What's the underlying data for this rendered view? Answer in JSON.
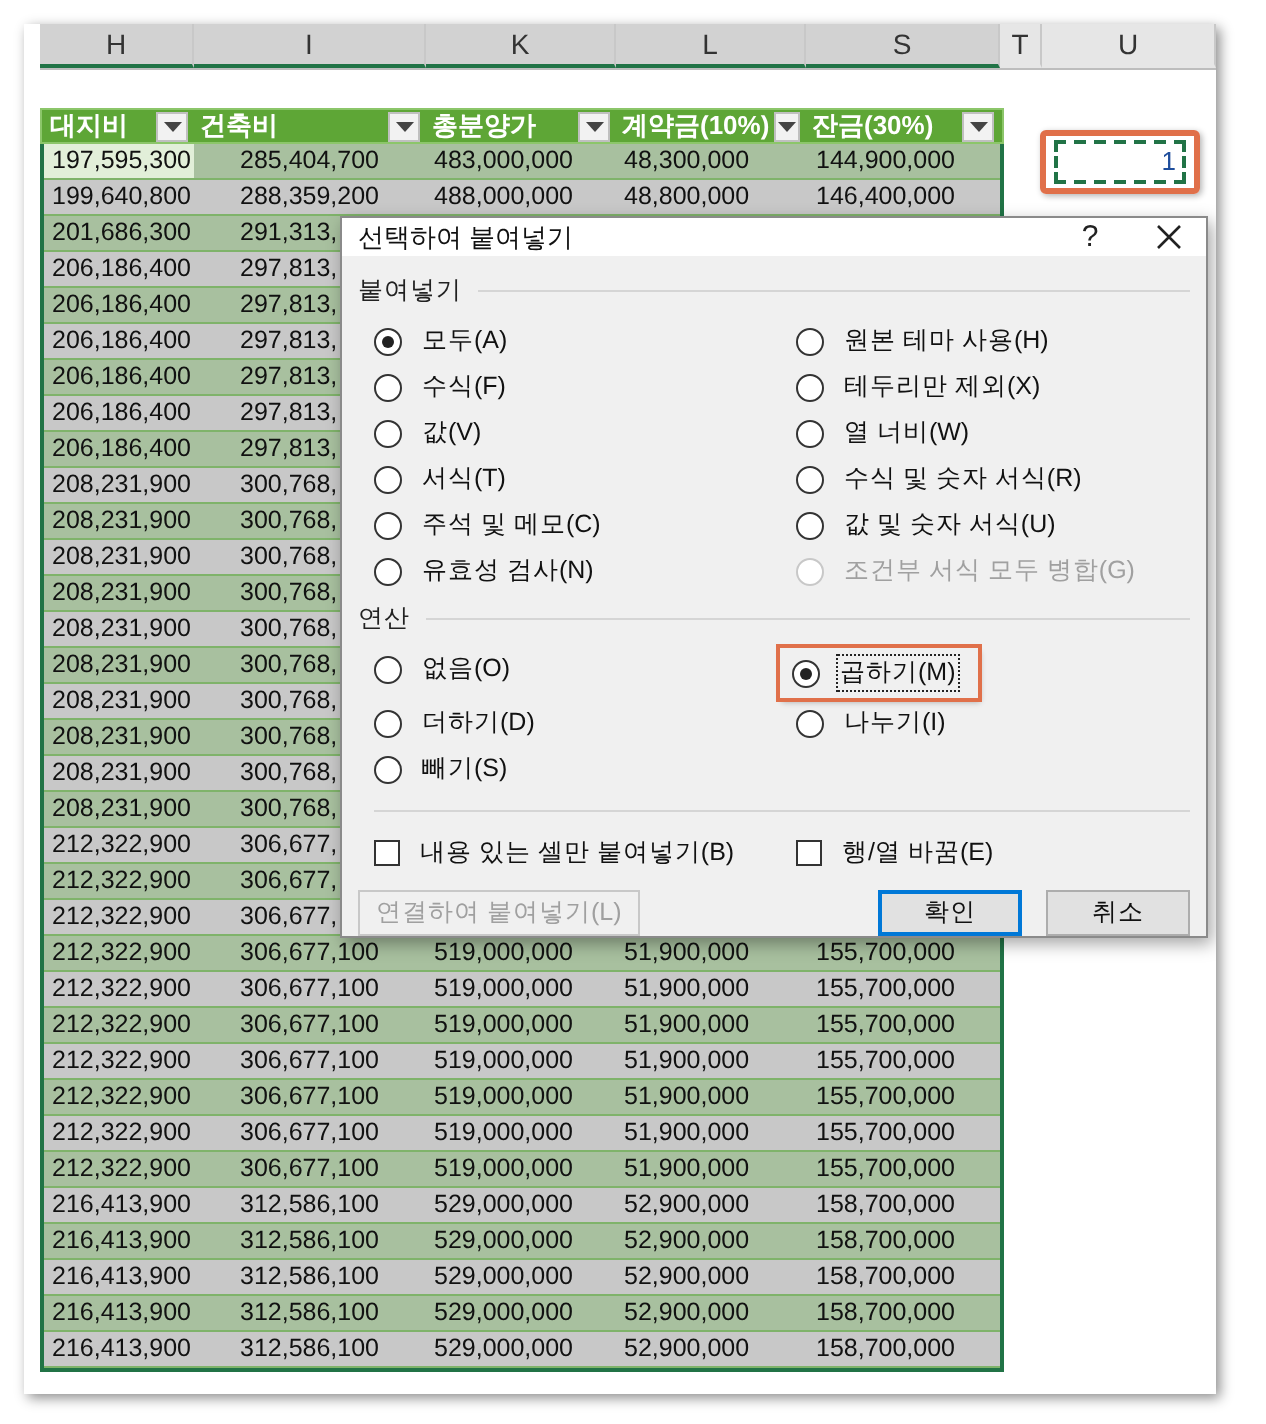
{
  "column_letters": [
    "H",
    "I",
    "K",
    "L",
    "S",
    "T",
    "U"
  ],
  "table": {
    "headers": [
      "대지비",
      "건축비",
      "총분양가",
      "계약금(10%)",
      "잔금(30%)"
    ],
    "rows": [
      {
        "current": true,
        "cells": [
          "197,595,300",
          "285,404,700",
          "483,000,000",
          "48,300,000",
          "144,900,000"
        ]
      },
      {
        "current": false,
        "cells": [
          "199,640,800",
          "288,359,200",
          "488,000,000",
          "48,800,000",
          "146,400,000"
        ]
      },
      {
        "current": false,
        "cells": [
          "201,686,300",
          "291,313,"
        ]
      },
      {
        "current": false,
        "cells": [
          "206,186,400",
          "297,813,"
        ]
      },
      {
        "current": false,
        "cells": [
          "206,186,400",
          "297,813,"
        ]
      },
      {
        "current": false,
        "cells": [
          "206,186,400",
          "297,813,"
        ]
      },
      {
        "current": false,
        "cells": [
          "206,186,400",
          "297,813,"
        ]
      },
      {
        "current": false,
        "cells": [
          "206,186,400",
          "297,813,"
        ]
      },
      {
        "current": false,
        "cells": [
          "206,186,400",
          "297,813,"
        ]
      },
      {
        "current": false,
        "cells": [
          "208,231,900",
          "300,768,"
        ]
      },
      {
        "current": false,
        "cells": [
          "208,231,900",
          "300,768,"
        ]
      },
      {
        "current": false,
        "cells": [
          "208,231,900",
          "300,768,"
        ]
      },
      {
        "current": false,
        "cells": [
          "208,231,900",
          "300,768,"
        ]
      },
      {
        "current": false,
        "cells": [
          "208,231,900",
          "300,768,"
        ]
      },
      {
        "current": false,
        "cells": [
          "208,231,900",
          "300,768,"
        ]
      },
      {
        "current": false,
        "cells": [
          "208,231,900",
          "300,768,"
        ]
      },
      {
        "current": false,
        "cells": [
          "208,231,900",
          "300,768,"
        ]
      },
      {
        "current": false,
        "cells": [
          "208,231,900",
          "300,768,"
        ]
      },
      {
        "current": false,
        "cells": [
          "208,231,900",
          "300,768,"
        ]
      },
      {
        "current": false,
        "cells": [
          "212,322,900",
          "306,677,"
        ]
      },
      {
        "current": false,
        "cells": [
          "212,322,900",
          "306,677,"
        ]
      },
      {
        "current": false,
        "cells": [
          "212,322,900",
          "306,677,"
        ]
      },
      {
        "current": false,
        "cells": [
          "212,322,900",
          "306,677,100",
          "519,000,000",
          "51,900,000",
          "155,700,000"
        ]
      },
      {
        "current": false,
        "cells": [
          "212,322,900",
          "306,677,100",
          "519,000,000",
          "51,900,000",
          "155,700,000"
        ]
      },
      {
        "current": false,
        "cells": [
          "212,322,900",
          "306,677,100",
          "519,000,000",
          "51,900,000",
          "155,700,000"
        ]
      },
      {
        "current": false,
        "cells": [
          "212,322,900",
          "306,677,100",
          "519,000,000",
          "51,900,000",
          "155,700,000"
        ]
      },
      {
        "current": false,
        "cells": [
          "212,322,900",
          "306,677,100",
          "519,000,000",
          "51,900,000",
          "155,700,000"
        ]
      },
      {
        "current": false,
        "cells": [
          "212,322,900",
          "306,677,100",
          "519,000,000",
          "51,900,000",
          "155,700,000"
        ]
      },
      {
        "current": false,
        "cells": [
          "212,322,900",
          "306,677,100",
          "519,000,000",
          "51,900,000",
          "155,700,000"
        ]
      },
      {
        "current": false,
        "cells": [
          "216,413,900",
          "312,586,100",
          "529,000,000",
          "52,900,000",
          "158,700,000"
        ]
      },
      {
        "current": false,
        "cells": [
          "216,413,900",
          "312,586,100",
          "529,000,000",
          "52,900,000",
          "158,700,000"
        ]
      },
      {
        "current": false,
        "cells": [
          "216,413,900",
          "312,586,100",
          "529,000,000",
          "52,900,000",
          "158,700,000"
        ]
      },
      {
        "current": false,
        "cells": [
          "216,413,900",
          "312,586,100",
          "529,000,000",
          "52,900,000",
          "158,700,000"
        ]
      },
      {
        "current": false,
        "cells": [
          "216,413,900",
          "312,586,100",
          "529,000,000",
          "52,900,000",
          "158,700,000"
        ]
      }
    ]
  },
  "copied_cell": {
    "value": "1",
    "highlighted": true
  },
  "dialog": {
    "title": "선택하여 붙여넣기",
    "help": "?",
    "paste": {
      "label": "붙여넣기",
      "options": [
        {
          "label": "모두(A)",
          "selected": true,
          "disabled": false
        },
        {
          "label": "원본 테마 사용(H)",
          "selected": false,
          "disabled": false
        },
        {
          "label": "수식(F)",
          "selected": false,
          "disabled": false
        },
        {
          "label": "테두리만 제외(X)",
          "selected": false,
          "disabled": false
        },
        {
          "label": "값(V)",
          "selected": false,
          "disabled": false
        },
        {
          "label": "열 너비(W)",
          "selected": false,
          "disabled": false
        },
        {
          "label": "서식(T)",
          "selected": false,
          "disabled": false
        },
        {
          "label": "수식 및 숫자 서식(R)",
          "selected": false,
          "disabled": false
        },
        {
          "label": "주석 및 메모(C)",
          "selected": false,
          "disabled": false
        },
        {
          "label": "값 및 숫자 서식(U)",
          "selected": false,
          "disabled": false
        },
        {
          "label": "유효성 검사(N)",
          "selected": false,
          "disabled": false
        },
        {
          "label": "조건부 서식 모두 병합(G)",
          "selected": false,
          "disabled": true
        }
      ]
    },
    "operation": {
      "label": "연산",
      "options": [
        {
          "label": "없음(O)",
          "selected": false,
          "highlighted": false,
          "focused": false
        },
        {
          "label": "곱하기(M)",
          "selected": true,
          "highlighted": true,
          "focused": true
        },
        {
          "label": "더하기(D)",
          "selected": false,
          "highlighted": false,
          "focused": false
        },
        {
          "label": "나누기(I)",
          "selected": false,
          "highlighted": false,
          "focused": false
        },
        {
          "label": "빼기(S)",
          "selected": false,
          "highlighted": false,
          "focused": false
        }
      ]
    },
    "checkboxes": [
      {
        "label": "내용 있는 셀만 붙여넣기(B)",
        "checked": false
      },
      {
        "label": "행/열 바꿈(E)",
        "checked": false
      }
    ],
    "buttons": [
      {
        "label": "연결하여 붙여넣기(L)",
        "disabled": true,
        "default": false
      },
      {
        "label": "확인",
        "disabled": false,
        "default": true
      },
      {
        "label": "취소",
        "disabled": false,
        "default": false
      }
    ]
  }
}
